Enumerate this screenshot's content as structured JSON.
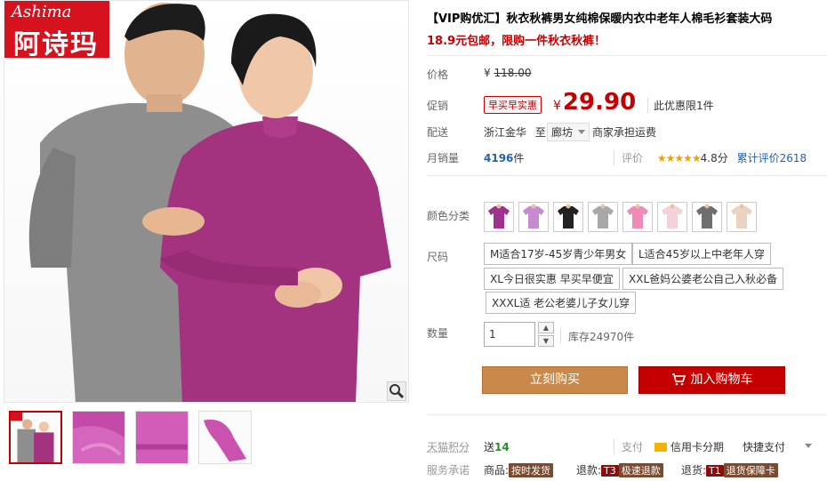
{
  "brand": {
    "script": "Ashima",
    "name": "阿诗玛"
  },
  "product": {
    "title": "【VIP购优汇】秋衣秋裤男女纯棉保暖内衣中老年人棉毛衫套装大码",
    "promo": "18.9元包邮，限购一件秋衣秋裤！"
  },
  "price": {
    "label": "价格",
    "original_symbol": "¥",
    "original": "118.00",
    "promo_label": "促销",
    "badge": "早买早实惠",
    "symbol": "¥",
    "current": "29.90",
    "limit": "此优惠限1件"
  },
  "shipping": {
    "label": "配送",
    "from": "浙江金华",
    "to_word": "至",
    "destination": "廊坊",
    "note": "商家承担运费"
  },
  "sales": {
    "label": "月销量",
    "count": "4196",
    "unit": "件",
    "rating_label": "评价",
    "stars": "★★★★★",
    "score": "4.8分",
    "reviews": "累计评价2618"
  },
  "colors": {
    "label": "颜色分类",
    "swatches": [
      {
        "name": "purple-top",
        "color": "#a0318c"
      },
      {
        "name": "lavender-top",
        "color": "#c58ad0"
      },
      {
        "name": "black-top",
        "color": "#222222"
      },
      {
        "name": "gray-top",
        "color": "#a8a8a8"
      },
      {
        "name": "pink-top",
        "color": "#f08ab9"
      },
      {
        "name": "light-pink-top",
        "color": "#f4d0d8"
      },
      {
        "name": "dark-gray-top",
        "color": "#6e6e6e"
      },
      {
        "name": "beige-top",
        "color": "#ead3c0"
      }
    ]
  },
  "sizes": {
    "label": "尺码",
    "options": [
      "M适合17岁-45岁青少年男女",
      "L适合45岁以上中老年人穿",
      "XL今日很实惠 早买早便宜",
      "XXL爸妈公婆老公自己入秋必备",
      "XXXL适 老公老婆儿子女儿穿"
    ]
  },
  "quantity": {
    "label": "数量",
    "value": "1",
    "up": "▲",
    "down": "▼",
    "stock": "库存24970件"
  },
  "actions": {
    "buy": "立刻购买",
    "cart": "加入购物车"
  },
  "extra": {
    "points_label": "天猫积分",
    "points_prefix": "送",
    "points": "14",
    "pay_label": "支付",
    "pay_credit": "信用卡分期",
    "pay_quick": "快捷支付",
    "service_label": "服务承诺",
    "goods_label": "商品:",
    "goods_tag": "按时发货",
    "return_label": "退款:",
    "return_code": "T3",
    "return_tag": "极速退款",
    "exchange_label": "退货:",
    "exchange_code": "T1",
    "exchange_tag": "退货保障卡"
  },
  "colors_theme": {
    "accent": "#c40000",
    "buy_button": "#c9894a",
    "link": "#2561a8"
  }
}
